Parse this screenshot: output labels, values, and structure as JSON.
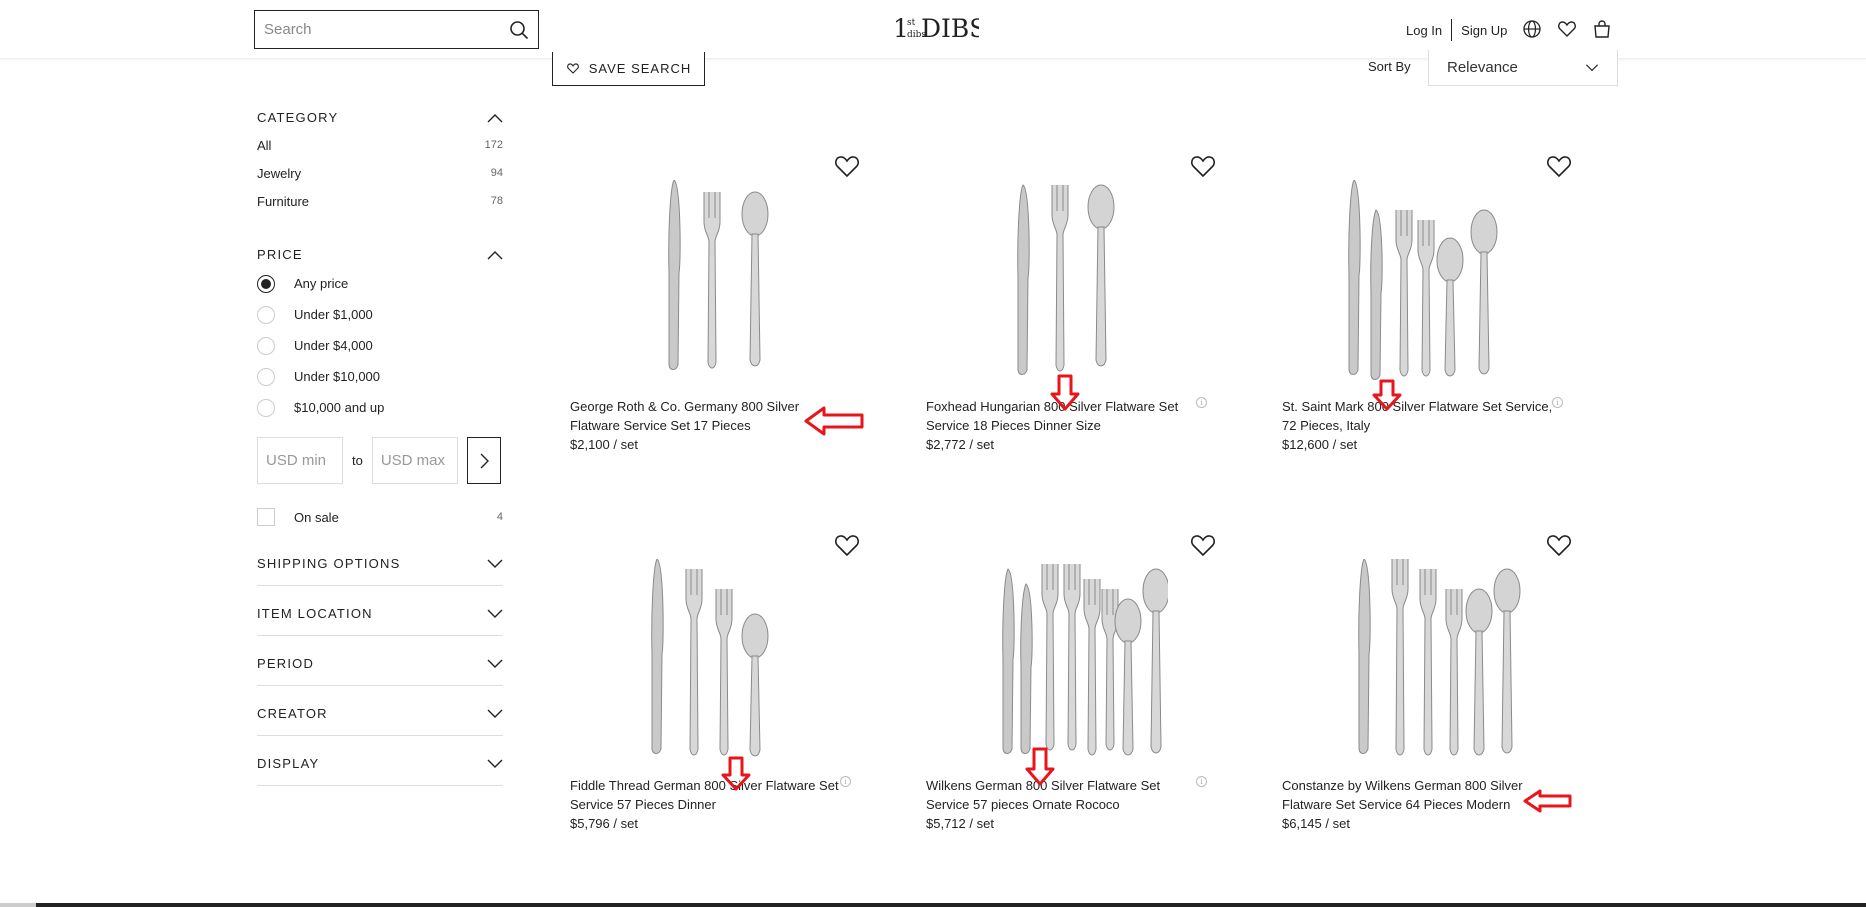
{
  "header": {
    "search_placeholder": "Search",
    "logo": {
      "part1": "1",
      "part2a": "st",
      "part2b": "dibs",
      "part3": "DIBS"
    },
    "login": "Log In",
    "signup": "Sign Up"
  },
  "sidebar": {
    "category": {
      "heading": "CATEGORY",
      "items": [
        {
          "label": "All",
          "count": "172"
        },
        {
          "label": "Jewelry",
          "count": "94"
        },
        {
          "label": "Furniture",
          "count": "78"
        }
      ]
    },
    "price": {
      "heading": "PRICE",
      "options": [
        {
          "label": "Any price",
          "selected": true
        },
        {
          "label": "Under $1,000",
          "selected": false
        },
        {
          "label": "Under $4,000",
          "selected": false
        },
        {
          "label": "Under $10,000",
          "selected": false
        },
        {
          "label": "$10,000 and up",
          "selected": false
        }
      ],
      "min_placeholder": "USD min",
      "max_placeholder": "USD max",
      "to_label": "to"
    },
    "onsale": {
      "label": "On sale",
      "count": "4"
    },
    "collapsed": [
      "SHIPPING OPTIONS",
      "ITEM LOCATION",
      "PERIOD",
      "CREATOR",
      "DISPLAY"
    ]
  },
  "toolbar": {
    "save_search": "SAVE SEARCH",
    "sort_by_label": "Sort By",
    "sort_value": "Relevance"
  },
  "products": [
    {
      "title": "George Roth & Co. Germany 800 Silver Flatware Service Set 17 Pieces",
      "price": "$2,100 / set"
    },
    {
      "title": "Foxhead Hungarian 800 Silver Flatware Set Service 18 Pieces Dinner Size",
      "price": "$2,772 / set"
    },
    {
      "title": "St. Saint Mark 800 Silver Flatware Set Service, 72 Pieces, Italy",
      "price": "$12,600 / set"
    },
    {
      "title": "Fiddle Thread German 800 Silver Flatware Set Service 57 Pieces Dinner",
      "price": "$5,796 / set"
    },
    {
      "title": "Wilkens German 800 Silver Flatware Set Service 57 pieces Ornate Rococo",
      "price": "$5,712 / set"
    },
    {
      "title": "Constanze by Wilkens German 800 Silver Flatware Set Service 64 Pieces Modern",
      "price": "$6,145 / set"
    }
  ],
  "colors": {
    "annotation_red": "#e8151b",
    "text": "#222222"
  }
}
